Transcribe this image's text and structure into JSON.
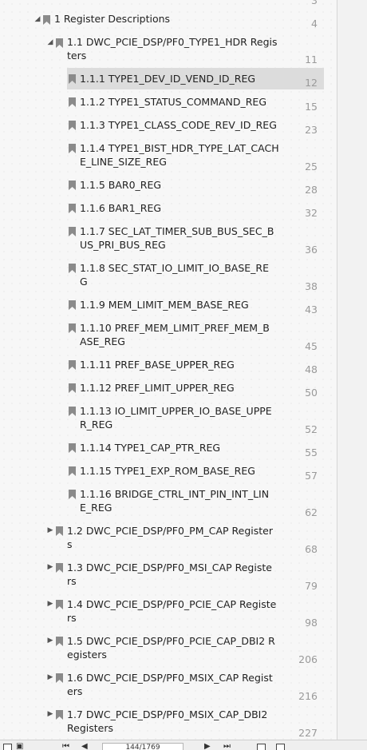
{
  "outline": {
    "partial_top_page": "3",
    "items": [
      {
        "label": "1 Register Descriptions",
        "page": "4"
      },
      {
        "label": "1.1 DWC_PCIE_DSP/PF0_TYPE1_HDR Registers",
        "line1": "1.1 DWC_PCIE_DSP/PF0_TYPE1_HDR Regis",
        "line2": "ters",
        "page": "11"
      },
      {
        "label": "1.1.1 TYPE1_DEV_ID_VEND_ID_REG",
        "page": "12"
      },
      {
        "label": "1.1.2 TYPE1_STATUS_COMMAND_REG",
        "page": "15"
      },
      {
        "label": "1.1.3 TYPE1_CLASS_CODE_REV_ID_REG",
        "page": "23"
      },
      {
        "line1": "1.1.4 TYPE1_BIST_HDR_TYPE_LAT_CACH",
        "line2": "E_LINE_SIZE_REG",
        "page": "25"
      },
      {
        "label": "1.1.5 BAR0_REG",
        "page": "28"
      },
      {
        "label": "1.1.6 BAR1_REG",
        "page": "32"
      },
      {
        "line1": "1.1.7 SEC_LAT_TIMER_SUB_BUS_SEC_B",
        "line2": "US_PRI_BUS_REG",
        "page": "36"
      },
      {
        "line1": "1.1.8 SEC_STAT_IO_LIMIT_IO_BASE_RE",
        "line2": "G",
        "page": "38"
      },
      {
        "label": "1.1.9 MEM_LIMIT_MEM_BASE_REG",
        "page": "43"
      },
      {
        "line1": "1.1.10 PREF_MEM_LIMIT_PREF_MEM_B",
        "line2": "ASE_REG",
        "page": "45"
      },
      {
        "label": "1.1.11 PREF_BASE_UPPER_REG",
        "page": "48"
      },
      {
        "label": "1.1.12 PREF_LIMIT_UPPER_REG",
        "page": "50"
      },
      {
        "line1": "1.1.13 IO_LIMIT_UPPER_IO_BASE_UPPE",
        "line2": "R_REG",
        "page": "52"
      },
      {
        "label": "1.1.14 TYPE1_CAP_PTR_REG",
        "page": "55"
      },
      {
        "label": "1.1.15 TYPE1_EXP_ROM_BASE_REG",
        "page": "57"
      },
      {
        "line1": "1.1.16 BRIDGE_CTRL_INT_PIN_INT_LIN",
        "line2": "E_REG",
        "page": "62"
      },
      {
        "line1": "1.2 DWC_PCIE_DSP/PF0_PM_CAP Register",
        "line2": "s",
        "page": "68"
      },
      {
        "line1": "1.3 DWC_PCIE_DSP/PF0_MSI_CAP Registe",
        "line2": "rs",
        "page": "79"
      },
      {
        "line1": "1.4 DWC_PCIE_DSP/PF0_PCIE_CAP Registe",
        "line2": "rs",
        "page": "98"
      },
      {
        "line1": "1.5 DWC_PCIE_DSP/PF0_PCIE_CAP_DBI2 R",
        "line2": "egisters",
        "page": "206"
      },
      {
        "line1": "1.6 DWC_PCIE_DSP/PF0_MSIX_CAP Regist",
        "line2": "ers",
        "page": "216"
      },
      {
        "line1": "1.7 DWC_PCIE_DSP/PF0_MSIX_CAP_DBI2",
        "line2": "Registers",
        "page": "227"
      }
    ]
  },
  "toolbar": {
    "page_field": "144/1769"
  },
  "colors": {
    "selected_bg": "#dcdcdc",
    "page_number": "#9a9a9a",
    "bookmark_icon": "#8a8a8a"
  }
}
